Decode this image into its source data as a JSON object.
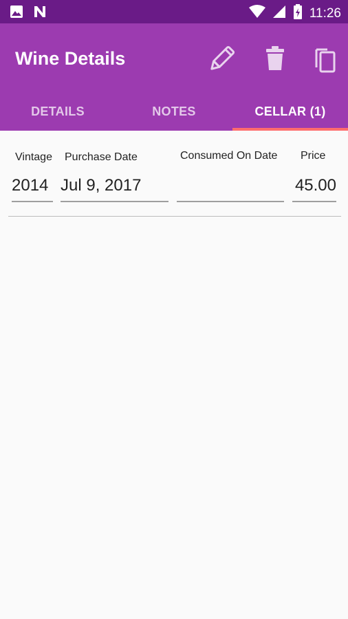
{
  "status_bar": {
    "time": "11:26",
    "left_icons": [
      "image-icon",
      "n-notification-icon"
    ],
    "right_icons": [
      "wifi-icon",
      "cell-signal-icon",
      "battery-icon"
    ]
  },
  "app_bar": {
    "title": "Wine Details",
    "background_color": "#9c3bb0",
    "actions": [
      {
        "name": "edit",
        "icon": "pencil-icon"
      },
      {
        "name": "delete",
        "icon": "trash-icon"
      },
      {
        "name": "copy",
        "icon": "copy-icon"
      }
    ]
  },
  "tabs": [
    {
      "label": "DETAILS",
      "active": false
    },
    {
      "label": "NOTES",
      "active": false
    },
    {
      "label": "CELLAR (1)",
      "active": true
    }
  ],
  "cellar": {
    "columns": {
      "vintage": "Vintage",
      "purchase_date": "Purchase Date",
      "consumed_on_date": "Consumed On Date",
      "price": "Price"
    },
    "row": {
      "vintage": "2014",
      "purchase_date": "Jul 9, 2017",
      "consumed_on_date": "",
      "price": "45.00"
    }
  }
}
